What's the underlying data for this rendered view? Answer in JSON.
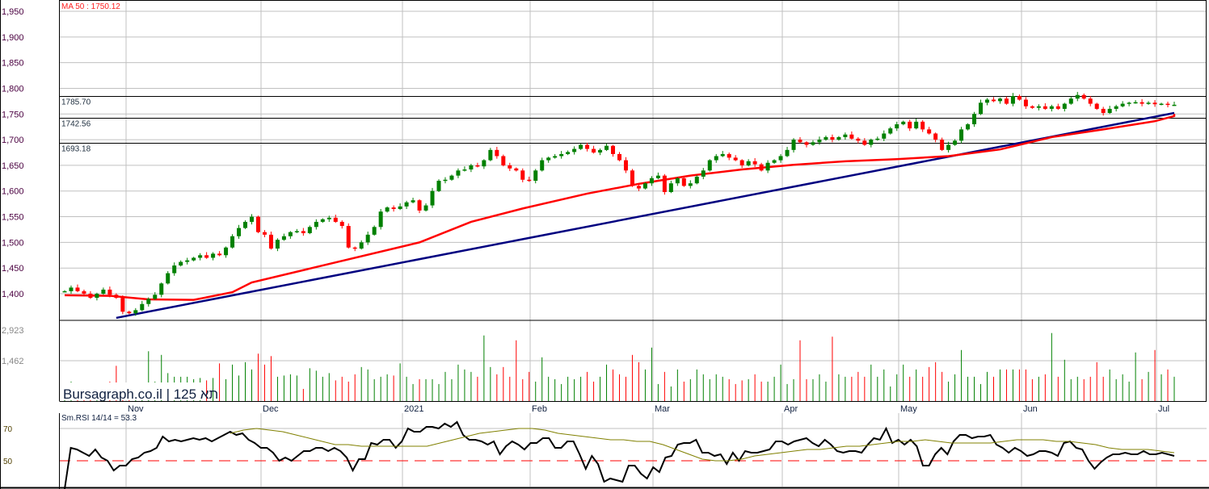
{
  "chart_data": {
    "type": "candlestick",
    "title": "Bursagraph.co.il | תא 125",
    "watermark": "Bursagraph.co.il | תא 125",
    "ma_label": "MA 50 : 1750.12",
    "y_ticks": [
      "1,950",
      "1,900",
      "1,850",
      "1,800",
      "1,750",
      "1,700",
      "1,650",
      "1,600",
      "1,550",
      "1,500",
      "1,450",
      "1,400"
    ],
    "y_tick_values": [
      1950,
      1900,
      1850,
      1800,
      1750,
      1700,
      1650,
      1600,
      1550,
      1500,
      1450,
      1400
    ],
    "ylim": [
      1350,
      1972
    ],
    "levels": [
      {
        "label": "1785.70",
        "value": 1785.7
      },
      {
        "label": "1742.56",
        "value": 1742.56
      },
      {
        "label": "1693.18",
        "value": 1693.18
      }
    ],
    "months": [
      "Nov",
      "Dec",
      "2021",
      "Feb",
      "Mar",
      "Apr",
      "May",
      "Jun",
      "Jul"
    ],
    "colors": {
      "up": "#008000",
      "down": "#ff0000",
      "ma": "#ff0000",
      "trend": "#000080",
      "rsi": "#000000",
      "signal": "#808000"
    },
    "closes": [
      1405,
      1412,
      1405,
      1400,
      1392,
      1400,
      1408,
      1398,
      1392,
      1365,
      1362,
      1368,
      1380,
      1390,
      1398,
      1420,
      1440,
      1455,
      1462,
      1465,
      1470,
      1475,
      1470,
      1478,
      1475,
      1490,
      1512,
      1528,
      1540,
      1550,
      1520,
      1515,
      1488,
      1505,
      1512,
      1520,
      1522,
      1518,
      1530,
      1540,
      1545,
      1548,
      1540,
      1532,
      1490,
      1488,
      1500,
      1515,
      1530,
      1560,
      1568,
      1565,
      1570,
      1578,
      1582,
      1562,
      1572,
      1600,
      1620,
      1622,
      1630,
      1640,
      1642,
      1650,
      1648,
      1660,
      1680,
      1668,
      1650,
      1644,
      1640,
      1622,
      1620,
      1640,
      1660,
      1665,
      1668,
      1672,
      1676,
      1682,
      1690,
      1682,
      1675,
      1680,
      1688,
      1672,
      1660,
      1640,
      1610,
      1605,
      1615,
      1625,
      1630,
      1598,
      1615,
      1625,
      1610,
      1615,
      1628,
      1640,
      1660,
      1668,
      1672,
      1665,
      1660,
      1650,
      1658,
      1652,
      1640,
      1655,
      1660,
      1668,
      1680,
      1700,
      1695,
      1690,
      1695,
      1700,
      1705,
      1700,
      1705,
      1710,
      1702,
      1698,
      1690,
      1700,
      1702,
      1712,
      1722,
      1730,
      1735,
      1722,
      1735,
      1720,
      1712,
      1700,
      1680,
      1690,
      1698,
      1720,
      1730,
      1750,
      1772,
      1778,
      1775,
      1780,
      1770,
      1785,
      1778,
      1765,
      1762,
      1765,
      1760,
      1765,
      1760,
      1770,
      1780,
      1787,
      1780,
      1770,
      1760,
      1752,
      1760,
      1765,
      1770,
      1772,
      1773,
      1770,
      1772,
      1769,
      1770,
      1768,
      1768
    ],
    "ma50": [
      [
        0,
        1397
      ],
      [
        7,
        1396
      ],
      [
        13,
        1389
      ],
      [
        20,
        1388
      ],
      [
        26,
        1403
      ],
      [
        29,
        1422
      ],
      [
        42,
        1461
      ],
      [
        55,
        1500
      ],
      [
        63,
        1540
      ],
      [
        71,
        1566
      ],
      [
        81,
        1595
      ],
      [
        89,
        1614
      ],
      [
        97,
        1630
      ],
      [
        105,
        1642
      ],
      [
        113,
        1651
      ],
      [
        121,
        1658
      ],
      [
        129,
        1662
      ],
      [
        137,
        1668
      ],
      [
        145,
        1681
      ],
      [
        153,
        1705
      ],
      [
        161,
        1720
      ],
      [
        169,
        1736
      ],
      [
        177,
        1746
      ],
      [
        181,
        1750.12
      ]
    ],
    "trendline": [
      [
        8,
        1353
      ],
      [
        181,
        1752
      ]
    ],
    "volume": {
      "ticks": [
        "2,923",
        "1,462"
      ],
      "tick_values": [
        2923,
        1462
      ],
      "values": [
        700,
        800,
        650,
        750,
        500,
        750,
        700,
        800,
        1450,
        700,
        750,
        650,
        650,
        2050,
        800,
        1900,
        1150,
        1000,
        1000,
        1000,
        900,
        950,
        850,
        950,
        1550,
        900,
        1500,
        1050,
        1600,
        1300,
        1950,
        1500,
        1850,
        1000,
        1050,
        1100,
        1050,
        500,
        1350,
        1250,
        1000,
        1150,
        850,
        1000,
        800,
        1100,
        1400,
        1300,
        900,
        1000,
        1100,
        1050,
        1550,
        1000,
        700,
        900,
        900,
        900,
        700,
        1200,
        900,
        1500,
        1300,
        1200,
        1000,
        2700,
        1400,
        1100,
        1400,
        1000,
        2500,
        900,
        1200,
        800,
        1800,
        1000,
        900,
        700,
        1000,
        900,
        1000,
        1200,
        800,
        1000,
        1500,
        1300,
        1100,
        1000,
        1900,
        1600,
        1300,
        2200,
        700,
        1200,
        600,
        1300,
        800,
        900,
        1300,
        1100,
        900,
        1100,
        1000,
        900,
        700,
        850,
        900,
        1100,
        800,
        800,
        1000,
        1500,
        700,
        900,
        2500,
        900,
        900,
        1100,
        800,
        2650,
        1100,
        1000,
        1000,
        1200,
        1000,
        1500,
        1000,
        1300,
        600,
        1100,
        1500,
        1000,
        1300,
        1000,
        1400,
        1600,
        1200,
        800,
        1100,
        2100,
        1000,
        1000,
        700,
        1200,
        1000,
        1300,
        1300,
        1300,
        1300,
        1300,
        900,
        1000,
        1100,
        2800,
        1000,
        1700,
        900,
        1000,
        900,
        1000,
        1600,
        1000,
        1300,
        900,
        1100,
        800,
        2000,
        900,
        1200,
        2100,
        1100,
        1300,
        1000,
        2900,
        1100,
        700,
        300
      ]
    },
    "rsi": {
      "label": "Sm.RSI 14/14 = 53.3",
      "ticks": [
        "70",
        "50"
      ],
      "tick_values": [
        70,
        50
      ],
      "values": [
        20,
        58,
        57,
        55,
        53,
        57,
        52,
        50,
        44,
        47,
        47,
        51,
        52,
        55,
        56,
        58,
        65,
        62,
        63,
        62,
        63,
        64,
        63,
        64,
        62,
        64,
        66,
        68,
        66,
        67,
        63,
        61,
        58,
        58,
        55,
        50,
        52,
        50,
        53,
        56,
        56,
        58,
        58,
        56,
        58,
        56,
        52,
        44,
        51,
        51,
        61,
        60,
        63,
        63,
        58,
        62,
        70,
        68,
        68,
        71,
        71,
        70,
        73,
        71,
        74,
        66,
        63,
        63,
        62,
        60,
        62,
        54,
        59,
        62,
        60,
        57,
        61,
        61,
        64,
        64,
        58,
        58,
        62,
        62,
        54,
        45,
        53,
        48,
        37,
        39,
        38,
        37,
        47,
        47,
        42,
        39,
        46,
        43,
        52,
        53,
        60,
        61,
        61,
        63,
        55,
        55,
        53,
        54,
        48,
        55,
        50,
        56,
        55,
        55,
        56,
        57,
        62,
        62,
        60,
        62,
        63,
        64,
        61,
        59,
        63,
        60,
        56,
        55,
        56,
        56,
        55,
        60,
        64,
        63,
        70,
        61,
        63,
        60,
        63,
        59,
        47,
        47,
        54,
        58,
        54,
        62,
        66,
        66,
        64,
        65,
        65,
        66,
        60,
        58,
        55,
        58,
        56,
        53,
        54,
        56,
        56,
        55,
        53,
        61,
        62,
        58,
        57,
        50,
        45,
        49,
        52,
        54,
        54,
        55,
        54,
        54,
        56,
        54,
        54,
        55,
        54,
        53
      ],
      "signal": [
        67,
        69,
        70,
        69,
        68,
        66,
        64,
        62,
        60,
        60,
        59,
        59,
        59,
        59,
        59,
        59,
        61,
        63,
        65,
        67,
        68,
        69,
        70,
        70,
        69,
        67,
        66,
        65,
        64,
        63,
        63,
        62,
        62,
        60,
        57,
        54,
        51,
        50,
        50,
        51,
        53,
        54,
        55,
        56,
        57,
        57,
        58,
        59,
        59,
        60,
        61,
        62,
        62,
        63,
        62,
        61,
        61,
        61,
        61,
        62,
        63,
        63,
        63,
        62,
        62,
        61,
        60,
        58,
        57,
        57,
        57,
        56,
        55
      ]
    }
  }
}
